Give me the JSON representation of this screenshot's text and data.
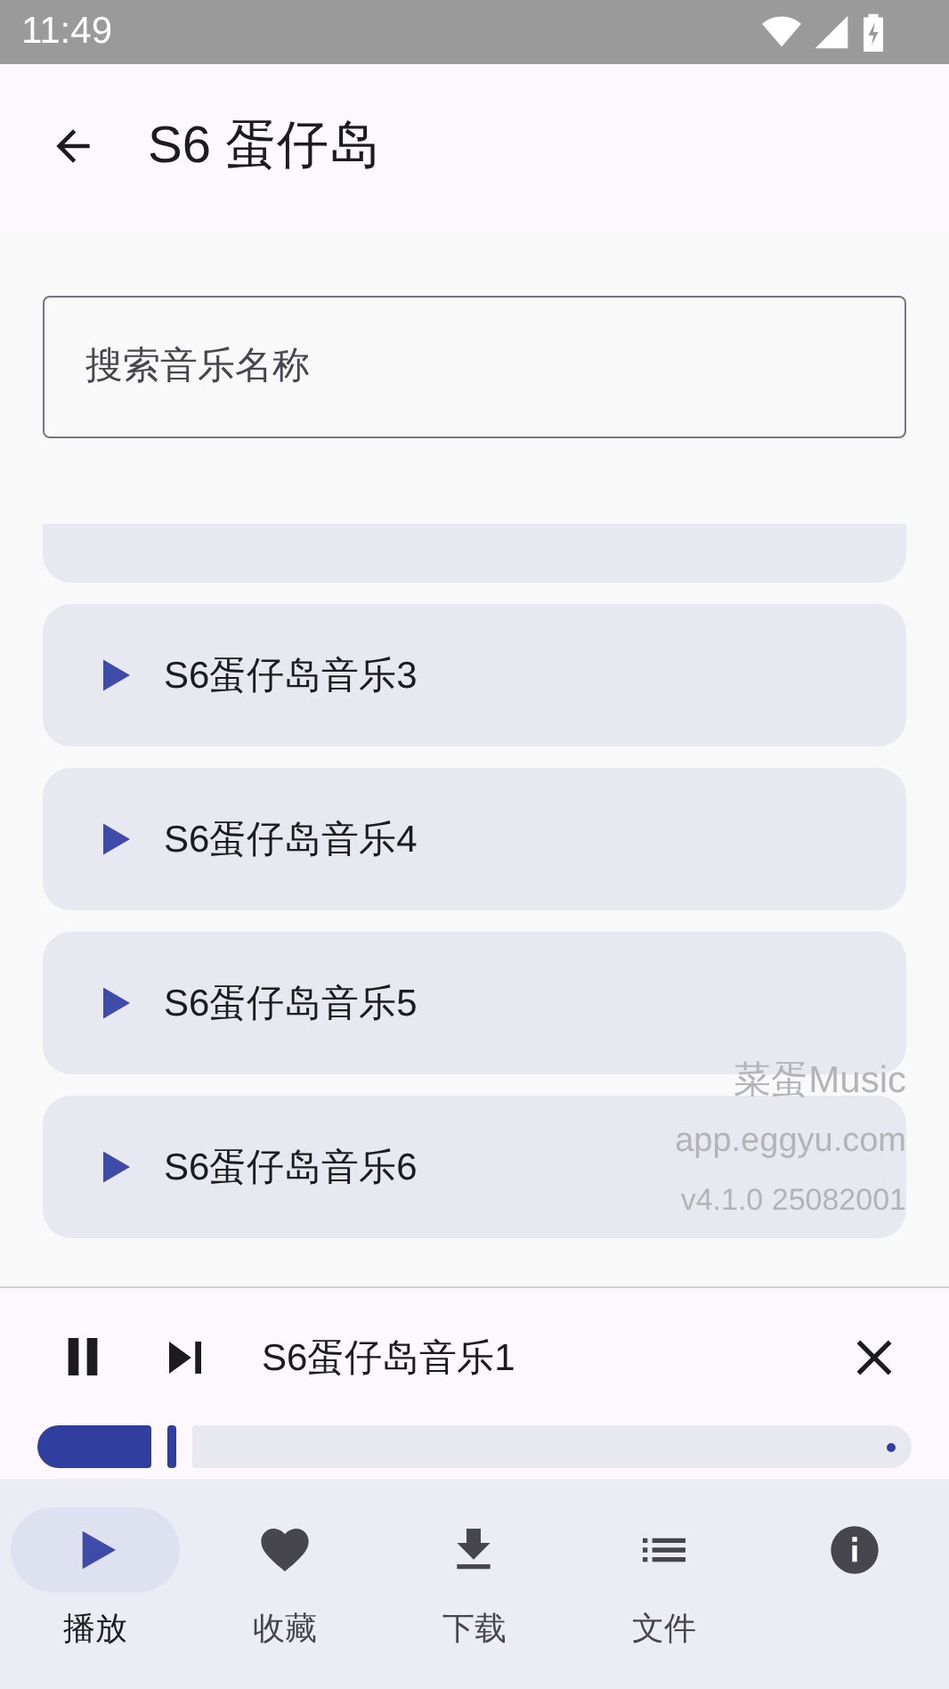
{
  "status_bar": {
    "time": "11:49"
  },
  "app_bar": {
    "title": "S6 蛋仔岛"
  },
  "search": {
    "placeholder": "搜索音乐名称"
  },
  "songs": [
    {
      "title": "S6蛋仔岛音乐3"
    },
    {
      "title": "S6蛋仔岛音乐4"
    },
    {
      "title": "S6蛋仔岛音乐5"
    },
    {
      "title": "S6蛋仔岛音乐6"
    }
  ],
  "about": {
    "app_name": "菜蛋Music",
    "site": "app.eggyu.com",
    "version": "v4.1.0 25082001"
  },
  "player": {
    "title": "S6蛋仔岛音乐1",
    "playing": true,
    "level": 0.14
  },
  "nav": [
    {
      "kind": "play",
      "label": "播放",
      "selected": true
    },
    {
      "kind": "favorite",
      "label": "收藏",
      "selected": false
    },
    {
      "kind": "download",
      "label": "下载",
      "selected": false
    },
    {
      "kind": "list",
      "label": "文件",
      "selected": false
    },
    {
      "kind": "info",
      "selected": false
    }
  ]
}
